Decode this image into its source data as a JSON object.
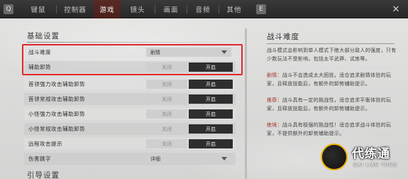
{
  "nav": {
    "left_key": "Q",
    "right_key": "E",
    "tabs": [
      {
        "label": "键鼠",
        "active": false
      },
      {
        "label": "控制器",
        "active": false
      },
      {
        "label": "游戏",
        "active": true
      },
      {
        "label": "镜头",
        "active": false
      },
      {
        "label": "画面",
        "active": false
      },
      {
        "label": "音频",
        "active": false
      },
      {
        "label": "其他",
        "active": false
      }
    ],
    "close": "✕"
  },
  "basic_settings": {
    "title": "基础设置",
    "rows": [
      {
        "label": "战斗难度",
        "type": "dropdown",
        "value": "剧情"
      },
      {
        "label": "辅助卸势",
        "type": "toggle",
        "off": "关闭",
        "on": "开启",
        "selected": "on"
      },
      {
        "label": "首领强力攻击辅助卸势",
        "type": "toggle",
        "off": "关闭",
        "on": "开启",
        "selected": "on"
      },
      {
        "label": "首领常规攻击辅助卸势",
        "type": "toggle",
        "off": "关闭",
        "on": "开启",
        "selected": "on"
      },
      {
        "label": "小怪强力攻击辅助卸势",
        "type": "toggle",
        "off": "关闭",
        "on": "开启",
        "selected": "on"
      },
      {
        "label": "小怪常规攻击辅助卸势",
        "type": "toggle",
        "off": "关闭",
        "on": "开启",
        "selected": "on"
      },
      {
        "label": "远程攻击提示",
        "type": "toggle",
        "off": "关闭",
        "on": "开启",
        "selected": "on"
      },
      {
        "label": "伤害跳字",
        "type": "dropdown",
        "value": "详细"
      }
    ]
  },
  "guide_settings": {
    "title": "引导设置"
  },
  "info_panel": {
    "title": "战斗难度",
    "intro": "战斗模式会影响到单人模式下绝大部分敌人的强度，只有少数玩法不受影响，包括太平武莽、试炼等。",
    "items": [
      {
        "key": "剧情：",
        "text": "战斗不会造成太大困扰，适合追求剧情体验的玩家，且释放技能后，有额外的卸势辅助提示。"
      },
      {
        "key": "推荐：",
        "text": "战斗具有一定的挑战性，适合追求平衡体验的玩家，且释放技能后，有额外的卸势辅助提示。"
      },
      {
        "key": "绝境：",
        "text": "战斗具有极强的挑战性！适合追求战斗体验的玩家，不提供额外的卸势辅助提示。"
      }
    ]
  },
  "watermark": {
    "name": "代练通",
    "sub": "DAI LIAN TONG"
  },
  "colors": {
    "highlight": "#e0282a",
    "active_tab": "#4a1f1b",
    "keyword": "#a8322a"
  }
}
